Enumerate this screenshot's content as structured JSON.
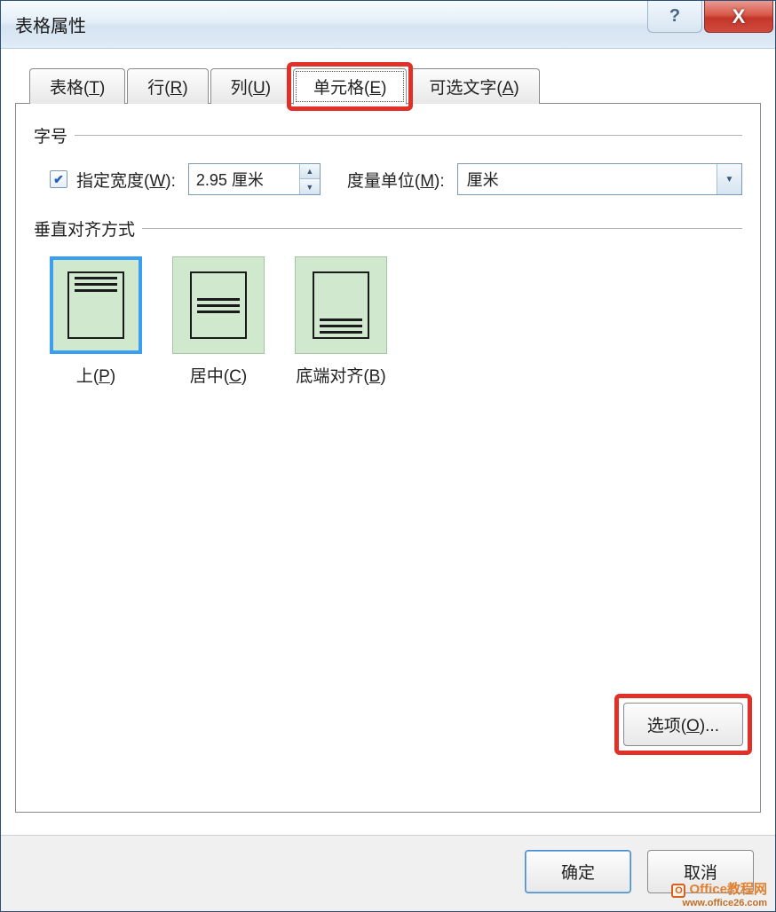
{
  "titlebar": {
    "title": "表格属性",
    "help_symbol": "?",
    "close_symbol": "X"
  },
  "tabs": [
    {
      "label_pre": "表格(",
      "accel": "T",
      "label_post": ")"
    },
    {
      "label_pre": "行(",
      "accel": "R",
      "label_post": ")"
    },
    {
      "label_pre": "列(",
      "accel": "U",
      "label_post": ")"
    },
    {
      "label_pre": "单元格(",
      "accel": "E",
      "label_post": ")"
    },
    {
      "label_pre": "可选文字(",
      "accel": "A",
      "label_post": ")"
    }
  ],
  "groups": {
    "size": {
      "title": "字号",
      "width_checkbox_pre": "指定宽度(",
      "width_checkbox_accel": "W",
      "width_checkbox_post": "):",
      "width_value": "2.95 厘米",
      "unit_label_pre": "度量单位(",
      "unit_label_accel": "M",
      "unit_label_post": "):",
      "unit_value": "厘米"
    },
    "valign": {
      "title": "垂直对齐方式",
      "options": [
        {
          "label_pre": "上(",
          "accel": "P",
          "label_post": ")"
        },
        {
          "label_pre": "居中(",
          "accel": "C",
          "label_post": ")"
        },
        {
          "label_pre": "底端对齐(",
          "accel": "B",
          "label_post": ")"
        }
      ]
    }
  },
  "buttons": {
    "options_pre": "选项(",
    "options_accel": "O",
    "options_post": ")...",
    "ok": "确定",
    "cancel": "取消"
  },
  "watermark": {
    "line1": "Office教程网",
    "line2": "www.office26.com"
  }
}
